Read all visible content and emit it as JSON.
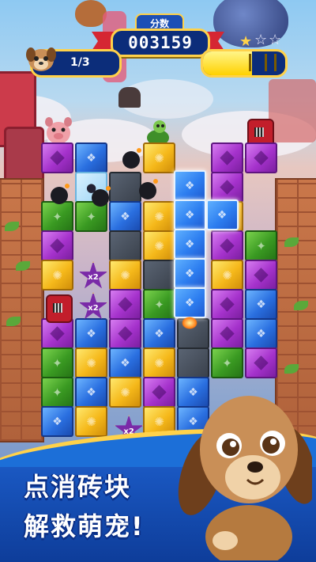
{
  "hud": {
    "score_label": "分数",
    "score_value": "003159",
    "rescued_count": "1/3",
    "progress_fraction": 0.6,
    "star_icon": "star-icon"
  },
  "board": {
    "multiplier_label": "x2"
  },
  "promo": {
    "line1": "点消砖块",
    "line2": "解救萌宠!"
  },
  "colors": {
    "score_panel": "#0c2d7a",
    "gold_trim": "#ffd24a",
    "banner_blue": "#1c6fd8"
  }
}
